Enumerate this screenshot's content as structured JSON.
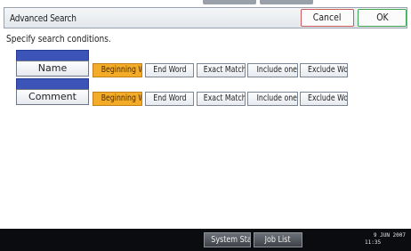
{
  "title": "Advanced Search",
  "buttons": {
    "cancel": "Cancel",
    "ok": "OK"
  },
  "instruction": "Specify search conditions.",
  "rows": [
    {
      "field": "Name",
      "options": [
        "Beginning Word",
        "End Word",
        "Exact Match",
        "Include one Word",
        "Exclude Words"
      ],
      "selected": "Beginning Word"
    },
    {
      "field": "Comment",
      "options": [
        "Beginning Word",
        "End Word",
        "Exact Match",
        "Include one Word",
        "Exclude Words"
      ],
      "selected": "Beginning Word"
    }
  ],
  "footer": {
    "system_status": "System Status",
    "job_list": "Job List",
    "date": "9 JUN 2007",
    "time": "11:35"
  },
  "colors": {
    "selected_option": "#f4ac28",
    "field_header": "#3c54b8",
    "cancel_border": "#cc5a5a",
    "ok_border": "#3fa44f",
    "footer_bg": "#0b0c10"
  }
}
